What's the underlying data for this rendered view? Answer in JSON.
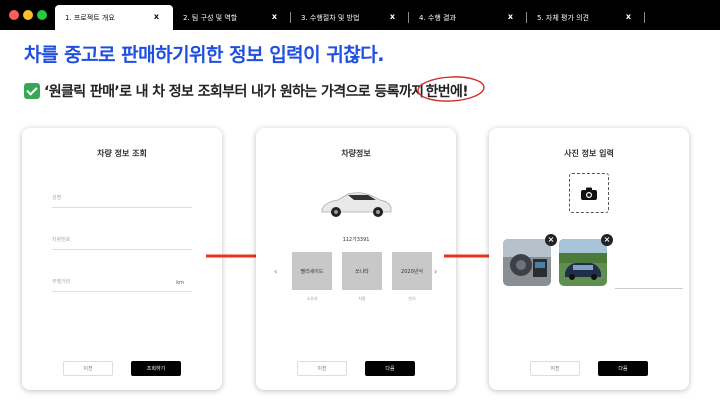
{
  "window": {
    "dots": [
      {
        "name": "close",
        "color": "#ff5f57"
      },
      {
        "name": "minimize",
        "color": "#febc2e"
      },
      {
        "name": "maximize",
        "color": "#28c840"
      }
    ]
  },
  "tabs": [
    {
      "label": "1. 프로젝트 개요",
      "close": "x",
      "active": true
    },
    {
      "label": "2. 팀 구성 및 역할",
      "close": "x",
      "active": false
    },
    {
      "label": "3. 수행절차 및 방법",
      "close": "x",
      "active": false
    },
    {
      "label": "4. 수행 결과",
      "close": "x",
      "active": false
    },
    {
      "label": "5. 자체 평가 의견",
      "close": "x",
      "active": false
    }
  ],
  "headline": "차를 중고로 판매하기위한 정보 입력이 귀찮다.",
  "subline": {
    "text": "‘원클릭 판매’로 내 차 정보 조회부터 내가 원하는 가격으로 등록까지",
    "circled": "한번에!"
  },
  "colors": {
    "headline": "#1f4fe0",
    "arrow": "#e8341c",
    "check": "#3aa757"
  },
  "cards": {
    "lookup": {
      "title": "차량 정보 조회",
      "fields": [
        {
          "placeholder": "성명",
          "unit": ""
        },
        {
          "placeholder": "차량번호",
          "unit": ""
        },
        {
          "placeholder": "주행거리",
          "unit": "km"
        }
      ],
      "buttons": {
        "prev": "이전",
        "next": "조회하기"
      }
    },
    "info": {
      "title": "차량정보",
      "plate": "112가3391",
      "options": [
        {
          "value": "팰리세이드",
          "label": "소유자"
        },
        {
          "value": "쏘나타",
          "label": "차종"
        },
        {
          "value": "2020년식",
          "label": "연식"
        }
      ],
      "buttons": {
        "prev": "이전",
        "next": "다음"
      }
    },
    "photo": {
      "title": "사진 정보 입력",
      "buttons": {
        "prev": "이전",
        "next": "다음"
      }
    }
  }
}
